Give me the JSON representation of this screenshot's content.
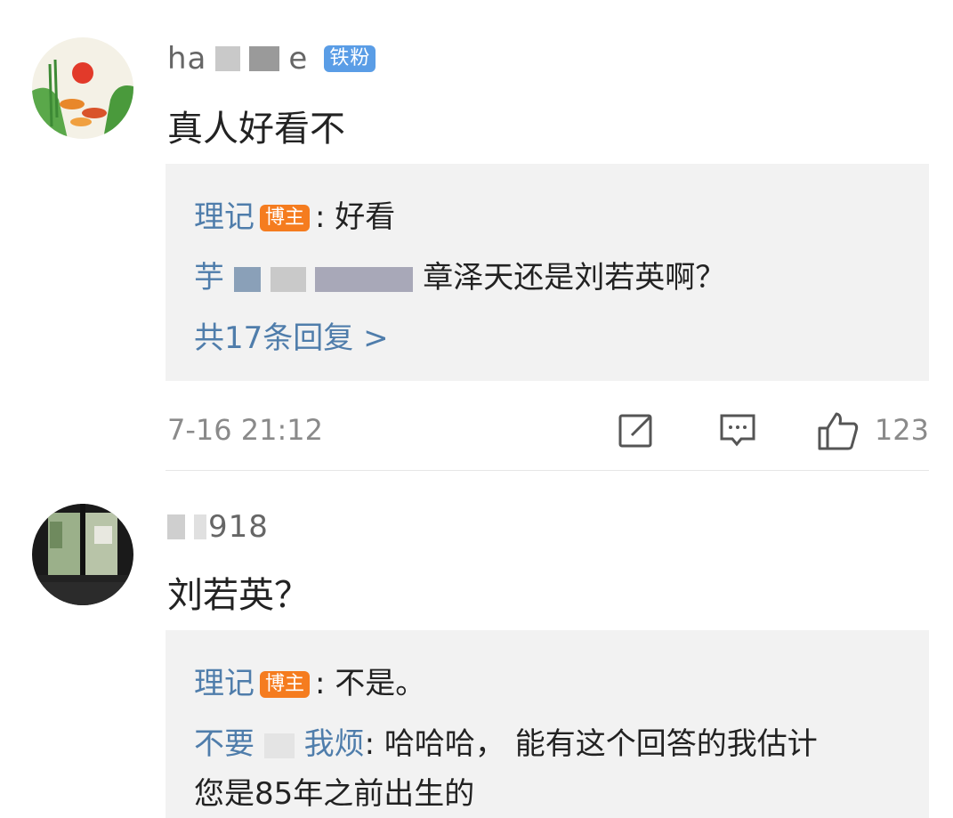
{
  "comments": [
    {
      "username_prefix": "ha",
      "username_suffix": "e",
      "fan_badge": "铁粉",
      "text": "真人好看不",
      "replies": [
        {
          "author": "理记",
          "badge": "博主",
          "text": ": 好看"
        },
        {
          "author_prefix": "芋",
          "text": "章泽天还是刘若英啊？"
        }
      ],
      "more_replies": "共17条回复 >",
      "timestamp": "7-16 21:12",
      "like_count": "123"
    },
    {
      "username_suffix": "918",
      "text": "刘若英？",
      "replies": [
        {
          "author": "理记",
          "badge": "博主",
          "text": ": 不是。"
        },
        {
          "author_prefix": "不要",
          "author_suffix": "我烦",
          "text": ": 哈哈哈， 能有这个回答的我估计",
          "text_line2": "您是85年之前出生的"
        }
      ]
    }
  ],
  "colors": {
    "link": "#4f7dab",
    "host_badge": "#f57c1f",
    "fan_badge": "#5a9de6",
    "reply_bg": "#f2f2f2"
  },
  "icons": [
    "edit-icon",
    "comment-icon",
    "like-icon",
    "chevron-right-icon"
  ]
}
